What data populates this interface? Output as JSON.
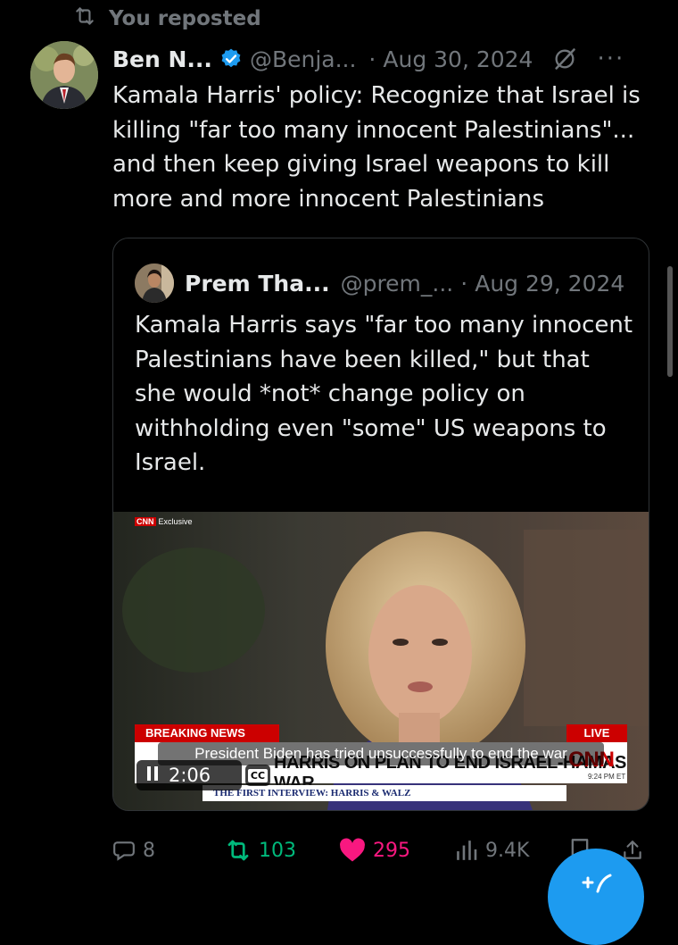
{
  "repost": {
    "label": "You reposted"
  },
  "post": {
    "author_name": "Ben N...",
    "handle": "@Benja...",
    "separator": "·",
    "date": "Aug 30, 2024",
    "more": "···",
    "text": "Kamala Harris' policy: Recognize that Israel is killing \"far too many innocent Palestinians\"... and then keep giving Israel weapons to kill more and more innocent Palestinians"
  },
  "quote": {
    "author_name": "Prem Tha...",
    "handle": "@prem_...",
    "separator": "·",
    "date": "Aug 29, 2024",
    "text": "Kamala Harris says \"far too many innocent Palestinians have been killed,\" but that she would *not* change policy on withholding even \"some\" US weapons to Israel.",
    "video": {
      "exclusive_logo": "CNN",
      "exclusive_tag": "Exclusive",
      "breaking": "BREAKING NEWS",
      "live": "LIVE",
      "headline": "HARRIS ON PLAN TO END ISRAEL-HAMAS WAR",
      "cnn_logo": "CNN",
      "time": "9:24 PM ET",
      "ticker": "THE FIRST INTERVIEW: HARRIS & WALZ",
      "caption": "President Biden has tried unsuccessfully to end the war",
      "duration": "2:06",
      "cc": "CC"
    }
  },
  "actions": {
    "replies": "8",
    "reposts": "103",
    "likes": "295",
    "views": "9.4K"
  },
  "colors": {
    "background": "#000000",
    "text": "#e7e9ea",
    "muted": "#71767b",
    "repost_green": "#00ba7c",
    "like_pink": "#f91880",
    "verified_blue": "#1d9bf0",
    "cnn_red": "#cc0000"
  }
}
